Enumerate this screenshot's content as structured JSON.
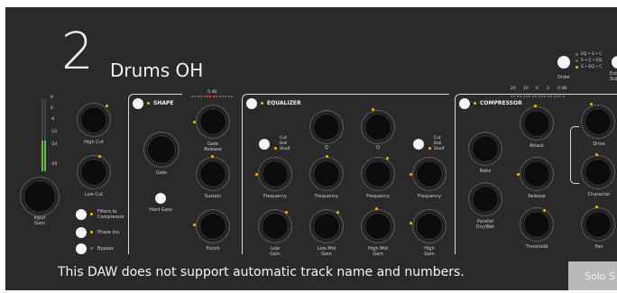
{
  "track": {
    "number": "2",
    "name": "Drums OH"
  },
  "meter": {
    "scale": [
      "6",
      "0",
      "-6",
      "-12",
      "-24",
      "-50"
    ]
  },
  "input": {
    "knob_label": "Input\nGain"
  },
  "filters": {
    "high_cut": "High Cut",
    "low_cut": "Low Cut",
    "toggles": [
      "Filters to\nCompressor",
      "Phase Inv.",
      "Bypass"
    ]
  },
  "shape": {
    "title": "SHAPE",
    "gate": "Gate",
    "hard_gate": "Hard Gate",
    "gate_release": "Gate\nRelease",
    "sustain": "Sustain",
    "punch": "Punch",
    "scale": "0 dB"
  },
  "equalizer": {
    "title": "EQUALIZER",
    "low_type_options": [
      "Cut",
      "Bell",
      "Shelf"
    ],
    "high_type_options": [
      "Cut",
      "Bell",
      "Shelf"
    ],
    "q_label": "Q",
    "frequency_labels": [
      "Frequency",
      "Frequency",
      "Frequency",
      "Frequency"
    ],
    "gain_labels": [
      "Low\nGain",
      "Low Mid\nGain",
      "High Mid\nGain",
      "High\nGain"
    ]
  },
  "compressor": {
    "title": "COMPRESSOR",
    "scale": [
      "20",
      "10",
      "6",
      "3",
      "0 dB"
    ],
    "ratio": "Ratio",
    "parallel": "Parallel\nDry/Wet",
    "attack": "Attack",
    "release": "Release",
    "threshold": "Threshold"
  },
  "output": {
    "drive": "Drive",
    "character": "Character",
    "pan": "Pan"
  },
  "order": {
    "label": "Order",
    "options": [
      "EQ • S • C",
      "S • C • EQ",
      "S • EQ • C"
    ],
    "ext_label": "Exte\nSide"
  },
  "footer": {
    "message": "This DAW does not support automatic track name and numbers.",
    "solo_label": "Solo S"
  },
  "colors": {
    "background": "#2a2a2a",
    "accent": "#f5b800",
    "meter_green": "#5fbf3f",
    "meter_red": "#e04040"
  }
}
